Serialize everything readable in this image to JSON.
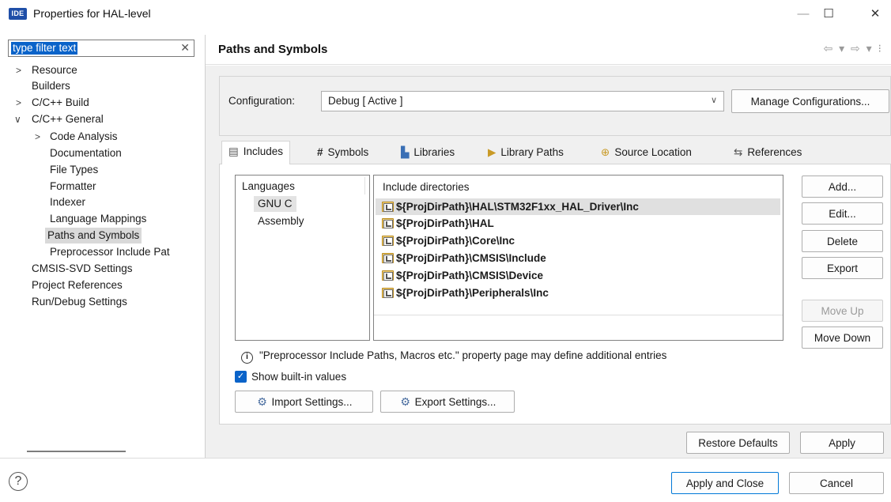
{
  "window": {
    "badge": "IDE",
    "title": "Properties for HAL-level",
    "minimize": "—",
    "maximize": "☐",
    "close": "✕"
  },
  "filter": {
    "value": "type filter text",
    "clear": "✕"
  },
  "nav": {
    "items": [
      {
        "label": "Resource",
        "twisty": ">"
      },
      {
        "label": "Builders"
      },
      {
        "label": "C/C++ Build",
        "twisty": ">"
      },
      {
        "label": "C/C++ General",
        "twisty": "∨"
      },
      {
        "label": "Code Analysis",
        "twisty": ">"
      },
      {
        "label": "Documentation"
      },
      {
        "label": "File Types"
      },
      {
        "label": "Formatter"
      },
      {
        "label": "Indexer"
      },
      {
        "label": "Language Mappings"
      },
      {
        "label": "Paths and Symbols"
      },
      {
        "label": "Preprocessor Include Pat"
      },
      {
        "label": "CMSIS-SVD Settings"
      },
      {
        "label": "Project References"
      },
      {
        "label": "Run/Debug Settings"
      }
    ]
  },
  "page": {
    "title": "Paths and Symbols",
    "history": "⇦ ▾ ⇨ ▾ ⁝"
  },
  "configuration": {
    "label": "Configuration:",
    "value": "Debug  [ Active ]",
    "arrow": "∨",
    "manage_button": "Manage Configurations..."
  },
  "tabs": [
    {
      "label": "Includes",
      "icon": "▤"
    },
    {
      "label": "Symbols",
      "icon": "#"
    },
    {
      "label": "Libraries",
      "icon": "▙"
    },
    {
      "label": "Library Paths",
      "icon": "▶"
    },
    {
      "label": "Source Location",
      "icon": "⊕"
    },
    {
      "label": "References",
      "icon": "⇆"
    }
  ],
  "languages": {
    "header": "Languages",
    "items": [
      "GNU C",
      "Assembly"
    ]
  },
  "includes": {
    "header": "Include directories",
    "rows": [
      "${ProjDirPath}\\HAL\\STM32F1xx_HAL_Driver\\Inc",
      "${ProjDirPath}\\HAL",
      "${ProjDirPath}\\Core\\Inc",
      "${ProjDirPath}\\CMSIS\\Include",
      "${ProjDirPath}\\CMSIS\\Device",
      "${ProjDirPath}\\Peripherals\\Inc"
    ]
  },
  "side_buttons": {
    "add": "Add...",
    "edit": "Edit...",
    "delete": "Delete",
    "export": "Export",
    "move_up": "Move Up",
    "move_down": "Move Down"
  },
  "info": {
    "icon": "i",
    "text": "\"Preprocessor Include Paths, Macros etc.\" property page may define additional entries"
  },
  "show_builtin": {
    "label": "Show built-in values",
    "check": "✓"
  },
  "settings_buttons": {
    "import": "Import Settings...",
    "export": "Export Settings..."
  },
  "page_buttons": {
    "restore": "Restore Defaults",
    "apply": "Apply"
  },
  "dialog_buttons": {
    "help": "?",
    "apply_close": "Apply and Close",
    "cancel": "Cancel"
  }
}
